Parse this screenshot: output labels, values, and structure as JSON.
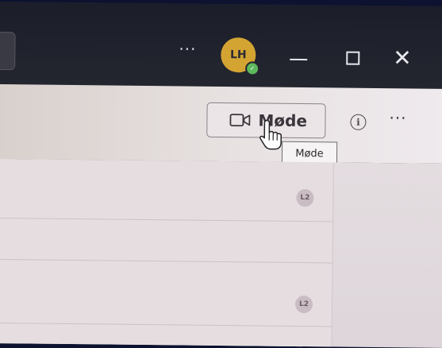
{
  "titlebar": {
    "more_label": "···",
    "avatar_initials": "LH",
    "presence_mark": "✓",
    "presence_color": "#5cb85c",
    "avatar_color": "#d4a433",
    "close_glyph": "✕"
  },
  "header": {
    "meet_button_label": "Møde",
    "info_glyph": "i",
    "more_label": "···",
    "tooltip": "Møde"
  },
  "list": {
    "rows": [
      {
        "badge": "L2"
      },
      {
        "badge": "L2"
      }
    ]
  }
}
